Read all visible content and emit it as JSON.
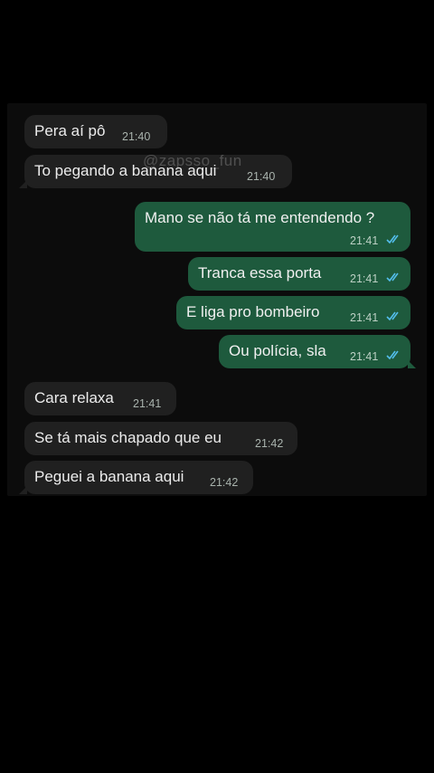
{
  "watermark": "@zapsso_fun",
  "messages": [
    {
      "text": "Pera aí pô",
      "time": "21:40",
      "direction": "incoming"
    },
    {
      "text": "To pegando a banana aqui",
      "time": "21:40",
      "direction": "incoming"
    },
    {
      "text": "Mano se não tá me entendendo ?",
      "time": "21:41",
      "direction": "outgoing",
      "status": "read-double-check-icon"
    },
    {
      "text": "Tranca essa porta",
      "time": "21:41",
      "direction": "outgoing",
      "status": "read-double-check-icon"
    },
    {
      "text": "E liga pro bombeiro",
      "time": "21:41",
      "direction": "outgoing",
      "status": "read-double-check-icon"
    },
    {
      "text": "Ou polícia, sla",
      "time": "21:41",
      "direction": "outgoing",
      "status": "read-double-check-icon"
    },
    {
      "text": "Cara relaxa",
      "time": "21:41",
      "direction": "incoming"
    },
    {
      "text": "Se tá mais chapado que eu",
      "time": "21:42",
      "direction": "incoming"
    },
    {
      "text": "Peguei a banana aqui",
      "time": "21:42",
      "direction": "incoming"
    }
  ],
  "colors": {
    "background": "#000000",
    "chat_background": "#0c0c0c",
    "incoming_bubble": "#202020",
    "outgoing_bubble": "#1e5a3d",
    "read_tick": "#53bdeb"
  }
}
